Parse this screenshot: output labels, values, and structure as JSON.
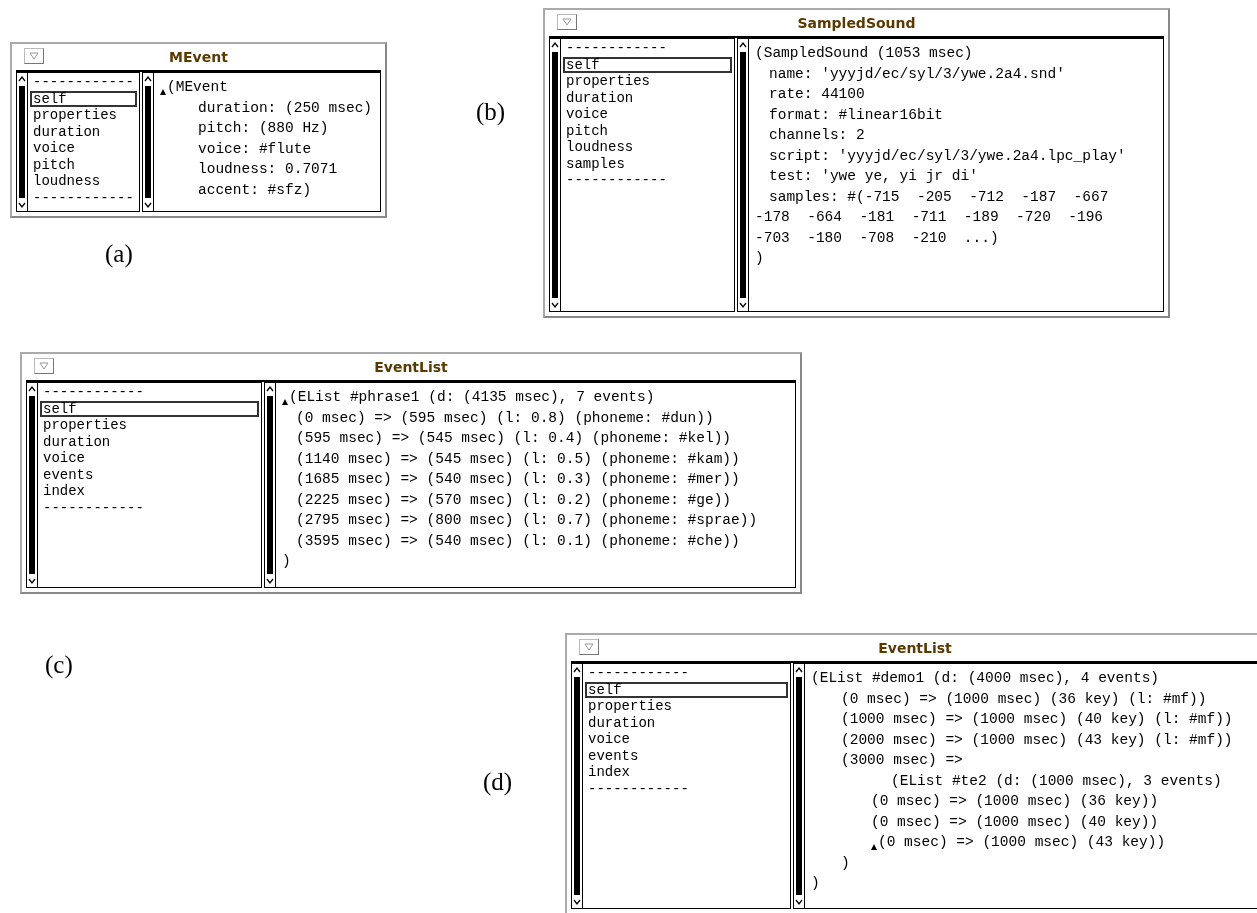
{
  "windows": [
    {
      "caption": "(a)",
      "title": "MEvent",
      "list_items": [
        {
          "text": "------------",
          "selected": false
        },
        {
          "text": "self",
          "selected": true
        },
        {
          "text": "properties",
          "selected": false
        },
        {
          "text": "duration",
          "selected": false
        },
        {
          "text": "voice",
          "selected": false
        },
        {
          "text": "pitch",
          "selected": false
        },
        {
          "text": "loudness",
          "selected": false
        },
        {
          "text": "------------",
          "selected": false
        }
      ],
      "code_lines": [
        {
          "text": "(MEvent",
          "kind": "head",
          "cursor": true
        },
        {
          "text": "duration: (250 msec)",
          "kind": "item",
          "cursor": false
        },
        {
          "text": "pitch: (880 Hz)",
          "kind": "item",
          "cursor": false
        },
        {
          "text": "voice: #flute",
          "kind": "item",
          "cursor": false
        },
        {
          "text": "loudness: 0.7071",
          "kind": "item",
          "cursor": false
        },
        {
          "text": "accent: #sfz)",
          "kind": "item",
          "cursor": false
        }
      ]
    },
    {
      "caption": "(b)",
      "title": "SampledSound",
      "list_items": [
        {
          "text": "------------",
          "selected": false
        },
        {
          "text": "self",
          "selected": true
        },
        {
          "text": "properties",
          "selected": false
        },
        {
          "text": "duration",
          "selected": false
        },
        {
          "text": "voice",
          "selected": false
        },
        {
          "text": "pitch",
          "selected": false
        },
        {
          "text": "loudness",
          "selected": false
        },
        {
          "text": "samples",
          "selected": false
        },
        {
          "text": "------------",
          "selected": false
        }
      ],
      "code_lines": [
        {
          "text": "(SampledSound (1053 msec)",
          "kind": "head",
          "cursor": false
        },
        {
          "text": "name: 'yyyjd/ec/syl/3/ywe.2a4.snd'",
          "kind": "item",
          "cursor": false
        },
        {
          "text": "rate: 44100",
          "kind": "item",
          "cursor": false
        },
        {
          "text": "format: #linear16bit",
          "kind": "item",
          "cursor": false
        },
        {
          "text": "channels: 2",
          "kind": "item",
          "cursor": false
        },
        {
          "text": "script: 'yyyjd/ec/syl/3/ywe.2a4.lpc_play'",
          "kind": "item",
          "cursor": false
        },
        {
          "text": "test: 'ywe ye, yi jr di'",
          "kind": "item",
          "cursor": false
        },
        {
          "text": "samples: #(-715  -205  -712  -187  -667",
          "kind": "item",
          "cursor": false
        },
        {
          "text": "-178  -664  -181  -711  -189  -720  -196",
          "kind": "wrap",
          "cursor": false
        },
        {
          "text": "-703  -180  -708  -210  ...)",
          "kind": "wrap",
          "cursor": false
        },
        {
          "text": ")",
          "kind": "close",
          "cursor": false
        }
      ]
    },
    {
      "caption": "(c)",
      "title": "EventList",
      "list_items": [
        {
          "text": "------------",
          "selected": false
        },
        {
          "text": "self",
          "selected": true
        },
        {
          "text": "properties",
          "selected": false
        },
        {
          "text": "duration",
          "selected": false
        },
        {
          "text": "voice",
          "selected": false
        },
        {
          "text": "events",
          "selected": false
        },
        {
          "text": "index",
          "selected": false
        },
        {
          "text": "------------",
          "selected": false
        }
      ],
      "code_lines": [
        {
          "text": "(EList #phrase1 (d: (4135 msec), 7 events)",
          "kind": "head",
          "cursor": true
        },
        {
          "text": "(0 msec) => (595 msec) (l: 0.8) (phoneme: #dun))",
          "kind": "item",
          "cursor": false
        },
        {
          "text": "(595 msec) => (545 msec) (l: 0.4) (phoneme: #kel))",
          "kind": "item",
          "cursor": false
        },
        {
          "text": "(1140 msec) => (545 msec) (l: 0.5) (phoneme: #kam))",
          "kind": "item",
          "cursor": false
        },
        {
          "text": "(1685 msec) => (540 msec) (l: 0.3) (phoneme: #mer))",
          "kind": "item",
          "cursor": false
        },
        {
          "text": "(2225 msec) => (570 msec) (l: 0.2) (phoneme: #ge))",
          "kind": "item",
          "cursor": false
        },
        {
          "text": "(2795 msec) => (800 msec) (l: 0.7) (phoneme: #sprae))",
          "kind": "item",
          "cursor": false
        },
        {
          "text": "(3595 msec) => (540 msec) (l: 0.1) (phoneme: #che))",
          "kind": "item",
          "cursor": false
        },
        {
          "text": ")",
          "kind": "close",
          "cursor": false
        }
      ]
    },
    {
      "caption": "(d)",
      "title": "EventList",
      "list_items": [
        {
          "text": "------------",
          "selected": false
        },
        {
          "text": "self",
          "selected": true
        },
        {
          "text": "properties",
          "selected": false
        },
        {
          "text": "duration",
          "selected": false
        },
        {
          "text": "voice",
          "selected": false
        },
        {
          "text": "events",
          "selected": false
        },
        {
          "text": "index",
          "selected": false
        },
        {
          "text": "------------",
          "selected": false
        }
      ],
      "code_lines": [
        {
          "text": "(EList #demo1 (d: (4000 msec), 4 events)",
          "kind": "head",
          "cursor": false
        },
        {
          "text": "(0 msec) => (1000 msec) (36 key) (l: #mf))",
          "kind": "item",
          "cursor": false
        },
        {
          "text": "(1000 msec) => (1000 msec) (40 key) (l: #mf))",
          "kind": "item",
          "cursor": false
        },
        {
          "text": "(2000 msec) => (1000 msec) (43 key) (l: #mf))",
          "kind": "item",
          "cursor": false
        },
        {
          "text": "(3000 msec) =>",
          "kind": "item",
          "cursor": false
        },
        {
          "text": "(EList #te2 (d: (1000 msec), 3 events)",
          "kind": "nested-head",
          "cursor": false
        },
        {
          "text": "(0 msec) => (1000 msec) (36 key))",
          "kind": "nested-item",
          "cursor": false
        },
        {
          "text": "(0 msec) => (1000 msec) (40 key))",
          "kind": "nested-item",
          "cursor": false
        },
        {
          "text": "(0 msec) => (1000 msec) (43 key))",
          "kind": "nested-item",
          "cursor": true
        },
        {
          "text": ")",
          "kind": "nested-close",
          "cursor": false
        },
        {
          "text": ")",
          "kind": "close",
          "cursor": false
        }
      ]
    }
  ]
}
